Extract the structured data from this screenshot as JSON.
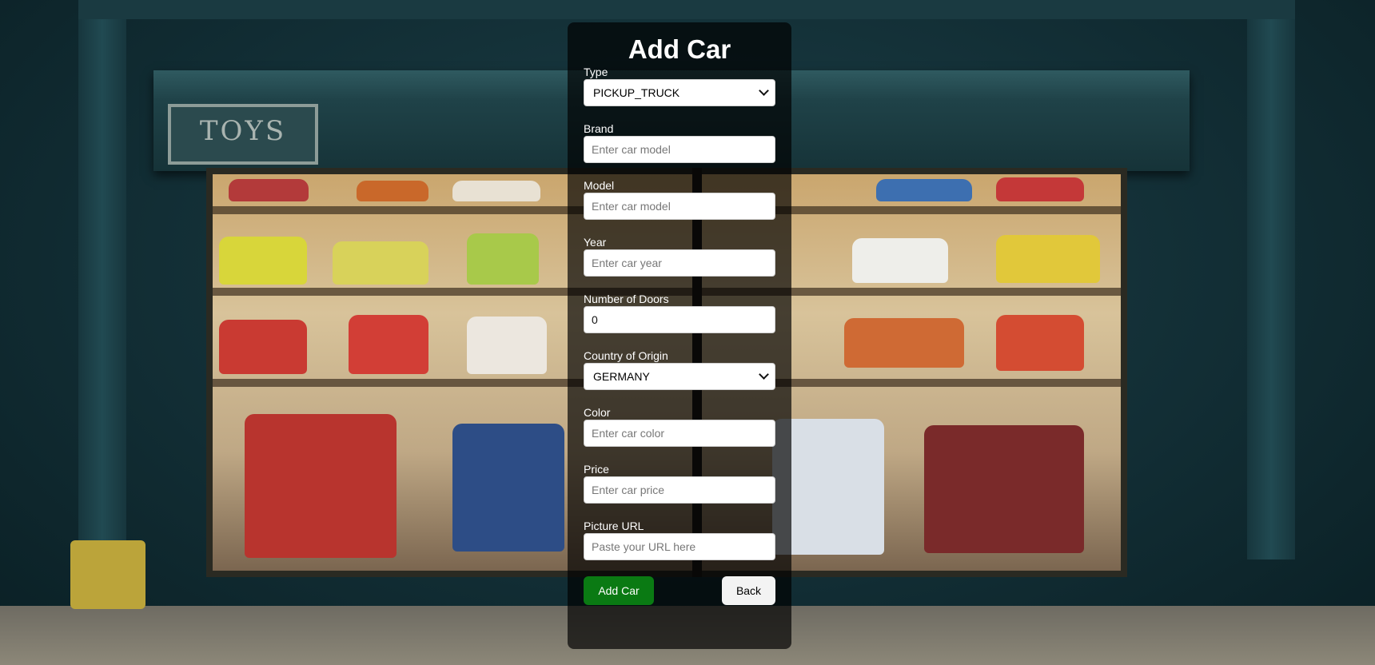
{
  "page": {
    "title": "Add Car"
  },
  "form": {
    "type": {
      "label": "Type",
      "value": "PICKUP_TRUCK"
    },
    "brand": {
      "label": "Brand",
      "placeholder": "Enter car model",
      "value": ""
    },
    "model": {
      "label": "Model",
      "placeholder": "Enter car model",
      "value": ""
    },
    "year": {
      "label": "Year",
      "placeholder": "Enter car year",
      "value": ""
    },
    "doors": {
      "label": "Number of Doors",
      "value": "0"
    },
    "country": {
      "label": "Country of Origin",
      "value": "GERMANY"
    },
    "color": {
      "label": "Color",
      "placeholder": "Enter car color",
      "value": ""
    },
    "price": {
      "label": "Price",
      "placeholder": "Enter car price",
      "value": ""
    },
    "picture": {
      "label": "Picture URL",
      "placeholder": "Paste your URL here",
      "value": ""
    }
  },
  "actions": {
    "add_label": "Add Car",
    "back_label": "Back"
  },
  "background": {
    "sign_text": "TOYS"
  },
  "colors": {
    "add_button": "#0a7a13",
    "card_overlay": "rgba(0,0,0,0.68)"
  }
}
